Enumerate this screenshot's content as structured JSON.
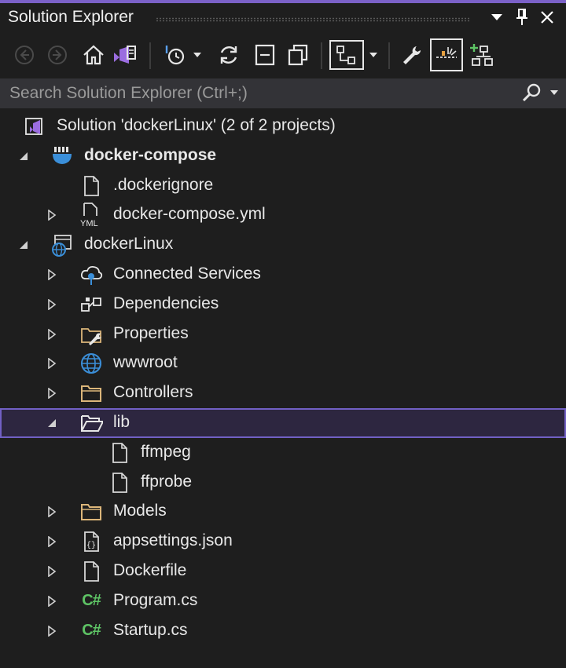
{
  "panel": {
    "title": "Solution Explorer"
  },
  "search": {
    "placeholder": "Search Solution Explorer (Ctrl+;)"
  },
  "tree": {
    "solution": "Solution 'dockerLinux' (2 of 2 projects)",
    "items": [
      {
        "label": "docker-compose",
        "icon": "docker-compose-icon",
        "bold": true
      },
      {
        "label": ".dockerignore",
        "icon": "file-icon"
      },
      {
        "label": "docker-compose.yml",
        "icon": "yml-file-icon"
      },
      {
        "label": "dockerLinux",
        "icon": "web-project-icon"
      },
      {
        "label": "Connected Services",
        "icon": "connected-services-icon"
      },
      {
        "label": "Dependencies",
        "icon": "dependencies-icon"
      },
      {
        "label": "Properties",
        "icon": "properties-icon"
      },
      {
        "label": "wwwroot",
        "icon": "globe-icon"
      },
      {
        "label": "Controllers",
        "icon": "folder-icon"
      },
      {
        "label": "lib",
        "icon": "folder-open-icon",
        "selected": true
      },
      {
        "label": "ffmpeg",
        "icon": "file-icon"
      },
      {
        "label": "ffprobe",
        "icon": "file-icon"
      },
      {
        "label": "Models",
        "icon": "folder-icon"
      },
      {
        "label": "appsettings.json",
        "icon": "json-file-icon"
      },
      {
        "label": "Dockerfile",
        "icon": "file-icon"
      },
      {
        "label": "Program.cs",
        "icon": "csharp-file-icon"
      },
      {
        "label": "Startup.cs",
        "icon": "csharp-file-icon"
      }
    ],
    "csharp_glyph": "C#"
  },
  "colors": {
    "accent": "#7b61c8",
    "background": "#1e1e1e",
    "selection_border": "#7160c4",
    "folder": "#dcb67a",
    "csharp": "#5ec465"
  }
}
